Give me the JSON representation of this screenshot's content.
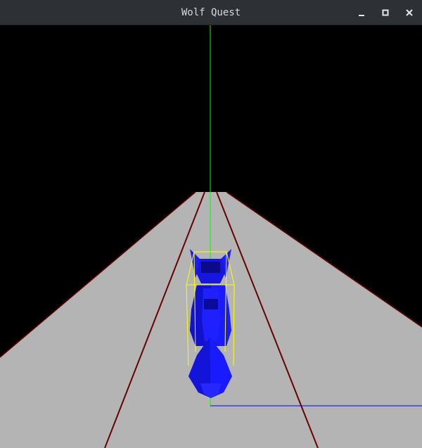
{
  "window": {
    "title": "Wolf Quest",
    "controls": [
      {
        "name": "minimize",
        "icon": "minimize-icon"
      },
      {
        "name": "maximize",
        "icon": "maximize-icon"
      },
      {
        "name": "close",
        "icon": "close-icon"
      }
    ]
  },
  "scene": {
    "background_color": "#000000",
    "ground_color": "#b4b4b4",
    "lane_line_color": "#6b0000",
    "y_axis_color": "#00ff00",
    "x_axis_color": "#0000ff",
    "bounding_box_color": "#ffff00",
    "wolf_color": "#1a1aff",
    "wolf_shade_color": "#0d0db0"
  }
}
